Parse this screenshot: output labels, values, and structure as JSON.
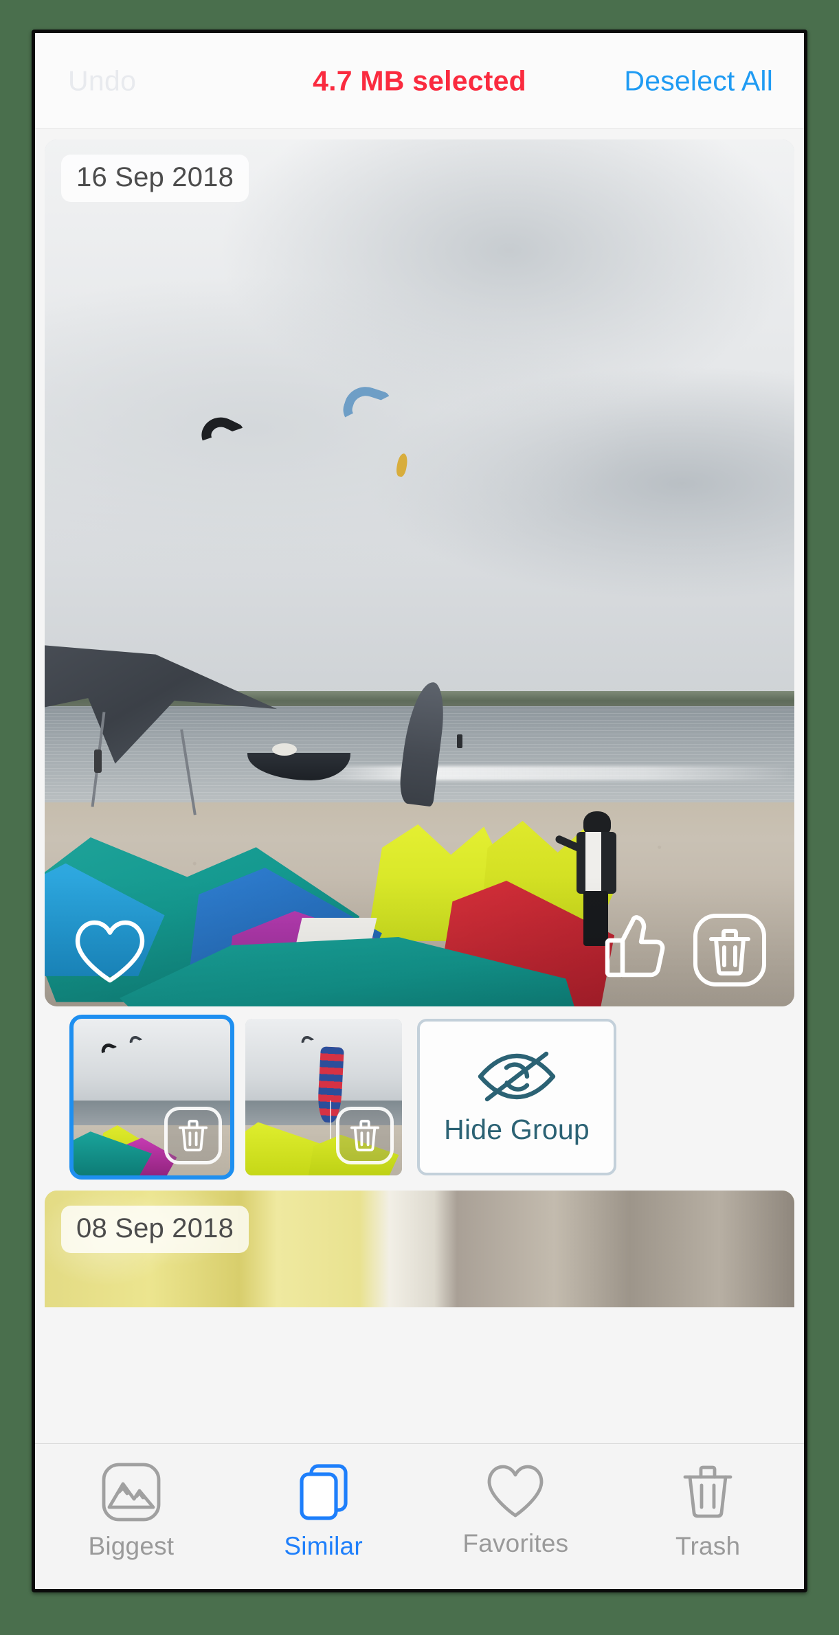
{
  "app": {
    "accent_blue": "#1E9BF3",
    "accent_red": "#FA2B3F",
    "teal": "#2B6274",
    "background": "#4A6F4D"
  },
  "topbar": {
    "undo_label": "Undo",
    "selected_label": "4.7 MB selected",
    "deselect_label": "Deselect All"
  },
  "hero": {
    "date": "16 Sep 2018",
    "favorite_icon": "heart-icon",
    "like_icon": "thumbs-up-icon",
    "delete_icon": "trash-icon"
  },
  "strip": {
    "thumbnails": [
      {
        "name": "thumbnail-1",
        "selected": true,
        "delete_icon": "trash-icon"
      },
      {
        "name": "thumbnail-2",
        "selected": false,
        "delete_icon": "trash-icon"
      }
    ],
    "hide_group": {
      "label": "Hide Group",
      "icon": "eye-slash-icon"
    }
  },
  "second_group": {
    "date": "08 Sep 2018"
  },
  "tabbar": {
    "items": [
      {
        "label": "Biggest",
        "icon": "mountain-icon",
        "active": false
      },
      {
        "label": "Similar",
        "icon": "stacked-cards-icon",
        "active": true
      },
      {
        "label": "Favorites",
        "icon": "heart-icon",
        "active": false
      },
      {
        "label": "Trash",
        "icon": "trash-icon",
        "active": false
      }
    ]
  }
}
